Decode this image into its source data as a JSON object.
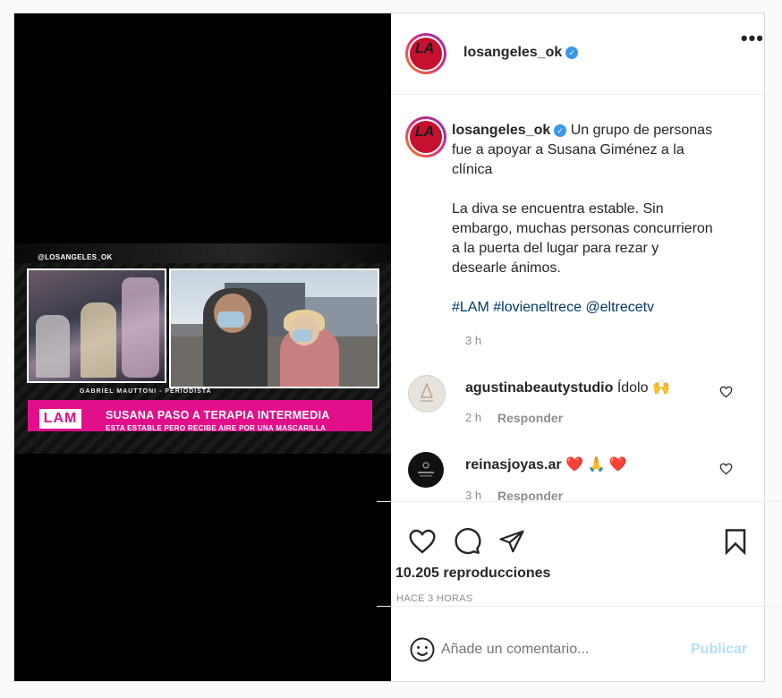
{
  "post": {
    "video": {
      "watermark": "@LOSANGELES_OK",
      "credit": "GABRIEL MAUTTONI - PERIODISTA",
      "logo": "LAM",
      "headline": "SUSANA PASO A TERAPIA INTERMEDIA",
      "subheadline": "ESTA ESTABLE PERO RECIBE AIRE POR UNA MASCARILLA"
    },
    "header": {
      "username": "losangeles_ok",
      "more": "•••"
    },
    "caption": {
      "username": "losangeles_ok",
      "text1": "Un grupo de personas fue a apoyar a Susana Giménez a la clínica",
      "text2": "La diva se encuentra estable. Sin embargo, muchas personas concurrieron a la puerta del lugar para rezar y desearle ánimos.",
      "tags": "#LAM #lovieneltrece @eltrecetv",
      "time": "3 h"
    },
    "comments": [
      {
        "username": "agustinabeautystudio",
        "text": "Ídolo 🙌",
        "time": "2 h",
        "reply": "Responder"
      },
      {
        "username": "reinasjoyas.ar",
        "text": "❤️ 🙏 ❤️",
        "time": "3 h",
        "reply": "Responder"
      }
    ],
    "views": "10.205 reproducciones",
    "ago": "HACE 3 HORAS",
    "add_comment": {
      "placeholder": "Añade un comentario...",
      "publish": "Publicar"
    },
    "colors": {
      "accent": "#e10f89",
      "link": "#00376b",
      "verified": "#3897f0",
      "publish_disabled": "#b2dffc"
    }
  }
}
